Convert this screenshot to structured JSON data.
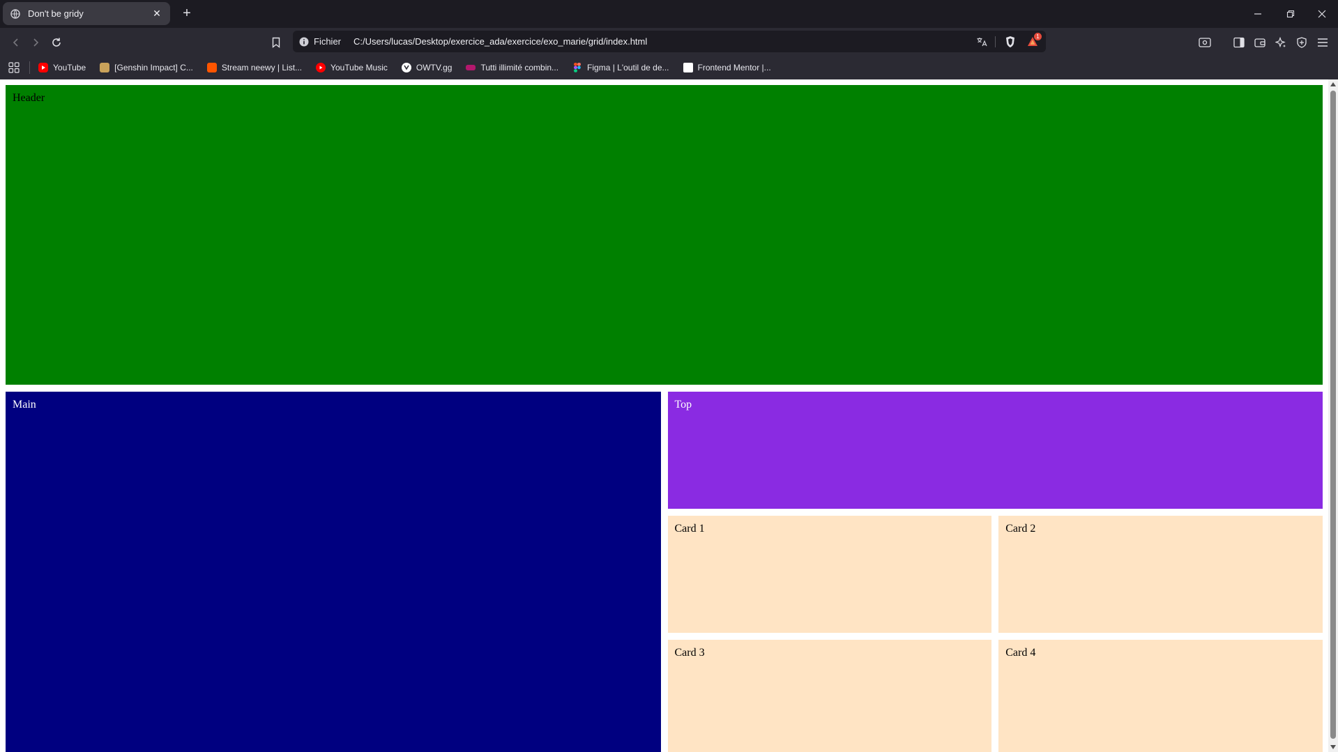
{
  "browser": {
    "tab": {
      "title": "Don't be gridy",
      "close_glyph": "✕",
      "favicon": "globe-icon"
    },
    "new_tab_glyph": "+",
    "window_controls": {
      "minimize": "—",
      "restore": "❐",
      "close": "✕"
    },
    "address": {
      "scheme_label": "Fichier",
      "url": "C:/Users/lucas/Desktop/exercice_ada/exercice/exo_marie/grid/index.html",
      "shields_badge": "1"
    },
    "bookmarks": [
      {
        "label": "YouTube",
        "icon": "youtube-icon",
        "color": "#ff0000"
      },
      {
        "label": "[Genshin Impact] C...",
        "icon": "genshin-icon",
        "color": "#c9a25a"
      },
      {
        "label": "Stream neewy | List...",
        "icon": "soundcloud-icon",
        "color": "#ff5500"
      },
      {
        "label": "YouTube Music",
        "icon": "youtube-music-icon",
        "color": "#ff0000"
      },
      {
        "label": "OWTV.gg",
        "icon": "owtv-icon",
        "color": "#ffffff"
      },
      {
        "label": "Tutti illimité combin...",
        "icon": "sncf-icon",
        "color": "#b3186d"
      },
      {
        "label": "Figma | L'outil de de...",
        "icon": "figma-icon",
        "color": "#f24e1e"
      },
      {
        "label": "Frontend Mentor |...",
        "icon": "frontend-mentor-icon",
        "color": "#ffffff"
      }
    ]
  },
  "page": {
    "header": {
      "label": "Header",
      "color": "#008000"
    },
    "main": {
      "label": "Main",
      "color": "#000080"
    },
    "top": {
      "label": "Top",
      "color": "#8a2be2"
    },
    "cards": [
      {
        "label": "Card 1"
      },
      {
        "label": "Card 2"
      },
      {
        "label": "Card 3"
      },
      {
        "label": "Card 4"
      }
    ],
    "card_color": "#ffe4c4"
  }
}
